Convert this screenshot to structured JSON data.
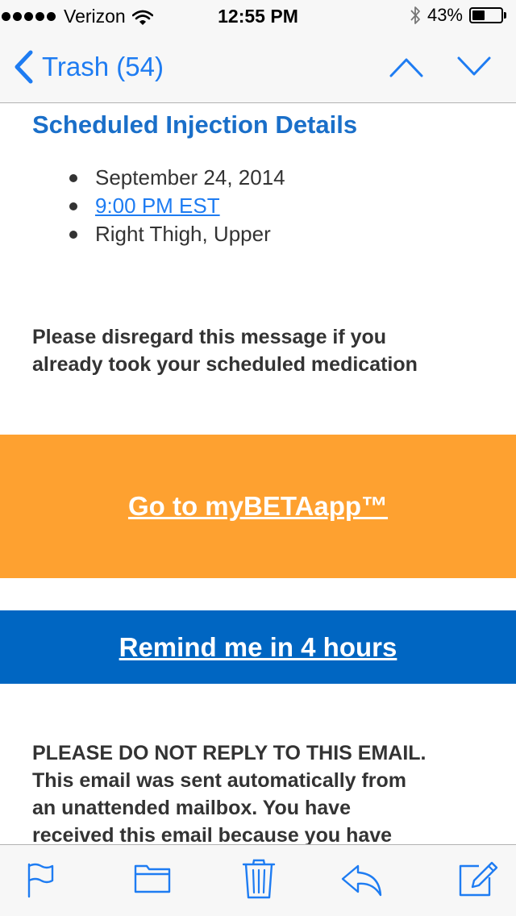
{
  "status_bar": {
    "carrier": "Verizon",
    "time": "12:55 PM",
    "battery_percent": "43%",
    "battery_level": 0.43,
    "signal_icon": "signal-dots-icon",
    "wifi_icon": "wifi-icon",
    "bluetooth_icon": "bluetooth-icon"
  },
  "nav": {
    "back_label": "Trash (54)",
    "accent": "#1e7cf2",
    "prev_icon": "chevron-up-icon",
    "next_icon": "chevron-down-icon"
  },
  "email": {
    "title": "Scheduled Injection Details",
    "details": [
      {
        "text": "September 24, 2014"
      },
      {
        "text": "9:00 PM EST"
      },
      {
        "text": "Right Thigh, Upper"
      }
    ],
    "notice_line1": "Please disregard this message if you",
    "notice_line2": "already took your scheduled medication",
    "primary_button": "Go to myBETAapp™",
    "primary_color": "#fea130",
    "secondary_button": "Remind me in 4 hours",
    "secondary_color": "#0066c2",
    "disclaimer_line1": "PLEASE DO NOT REPLY TO THIS EMAIL.",
    "disclaimer_line2": "This email was sent automatically from",
    "disclaimer_line3": "an unattended mailbox. You have",
    "disclaimer_line4": "received this email because you have"
  },
  "toolbar": {
    "items": [
      "flag-icon",
      "folder-icon",
      "trash-icon",
      "reply-icon",
      "compose-icon"
    ]
  }
}
